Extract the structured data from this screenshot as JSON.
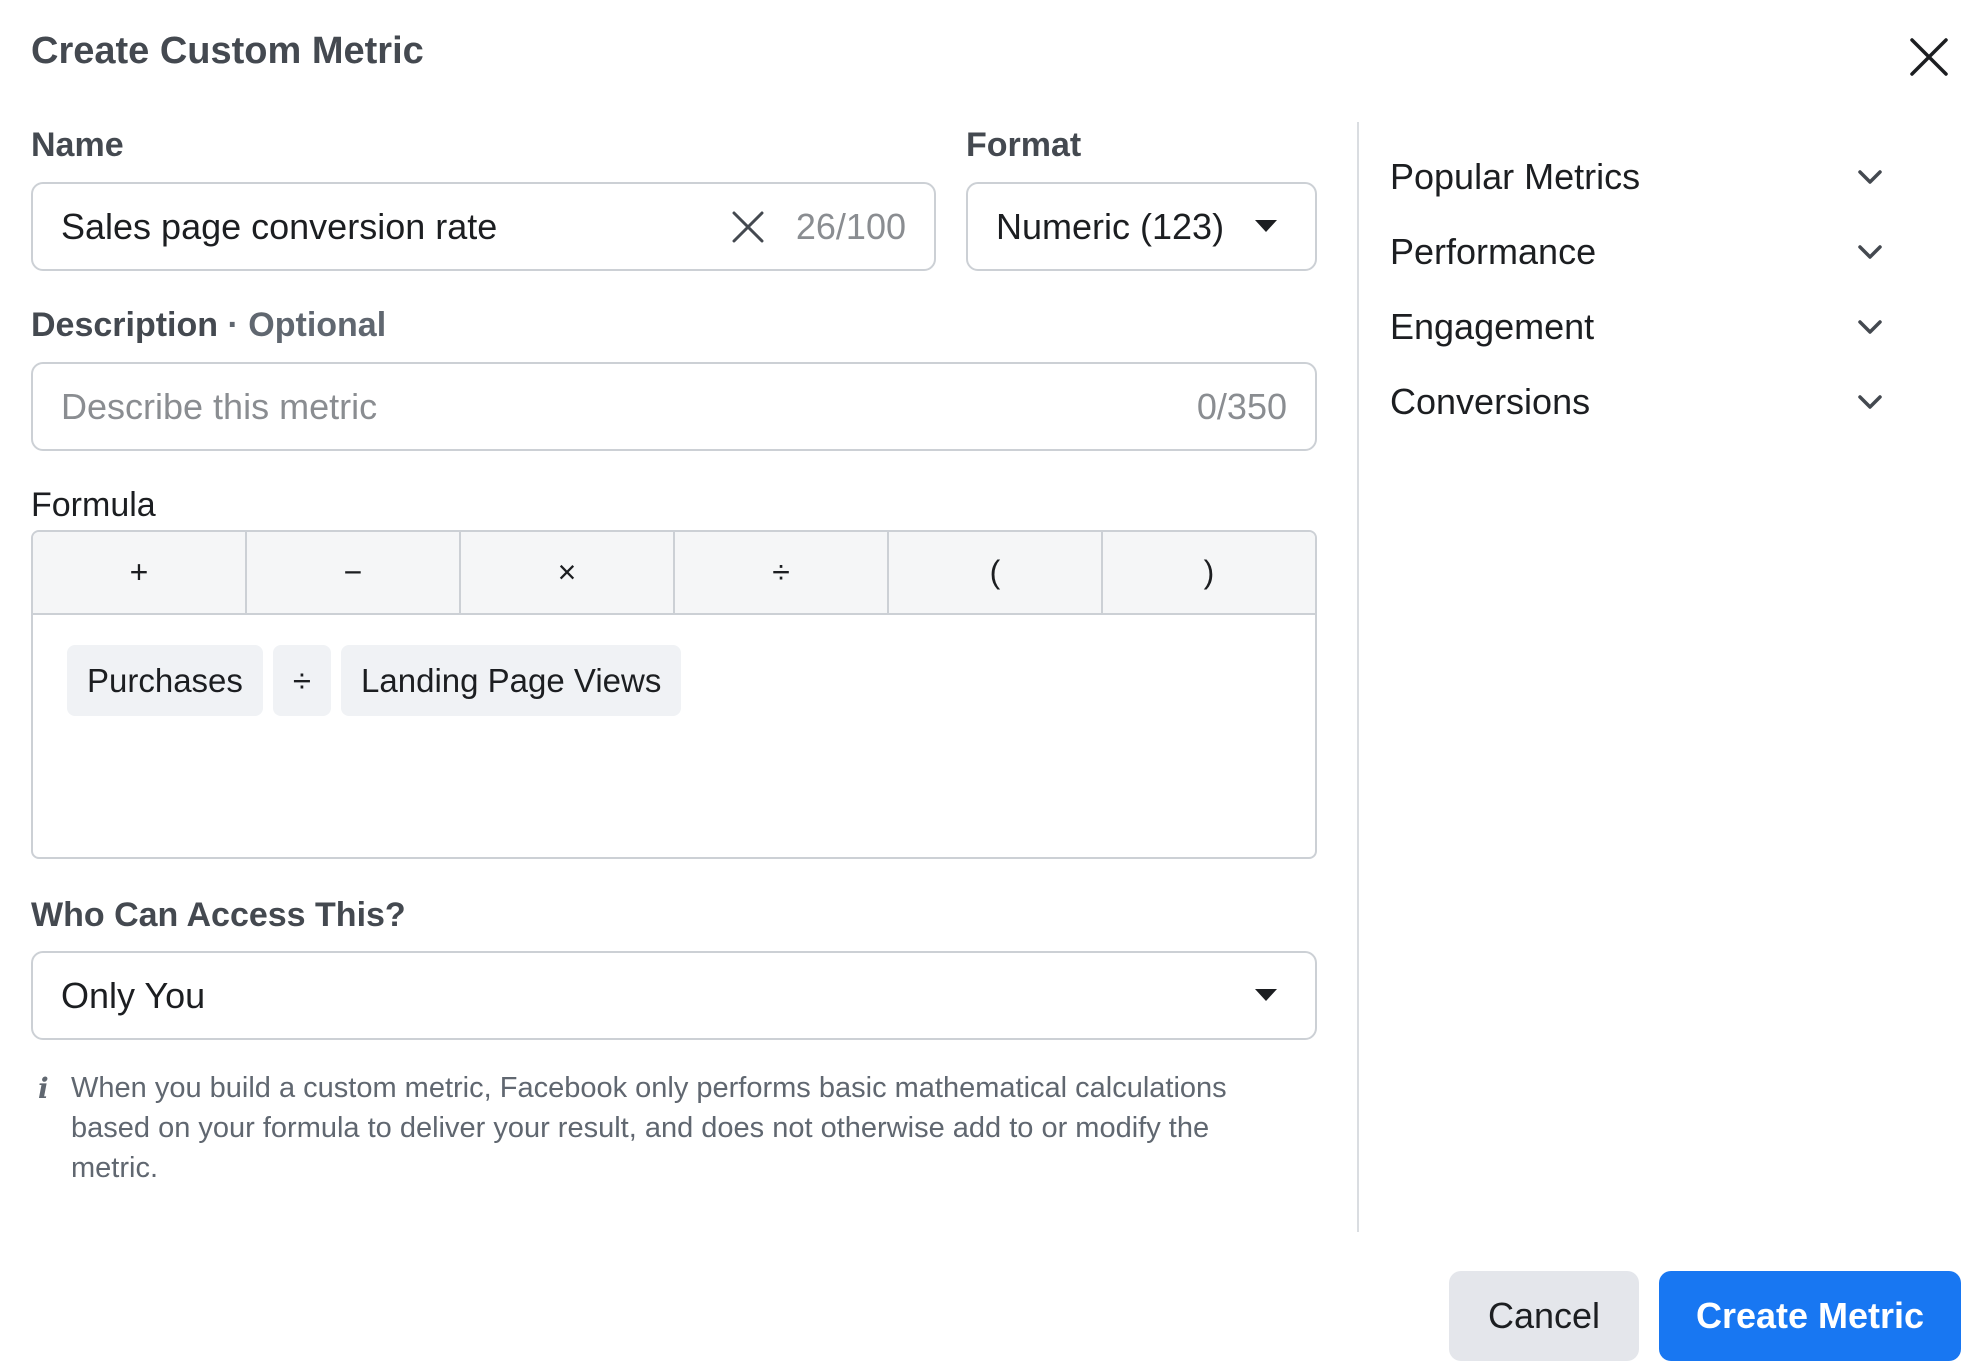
{
  "dialog": {
    "title": "Create Custom Metric",
    "close_icon": "close-icon"
  },
  "name": {
    "label": "Name",
    "value": "Sales page conversion rate",
    "counter": "26/100",
    "clear_icon": "clear-x-icon"
  },
  "format": {
    "label": "Format",
    "value": "Numeric (123)"
  },
  "description": {
    "label": "Description",
    "separator": "·",
    "optional": "Optional",
    "placeholder": "Describe this metric",
    "counter": "0/350"
  },
  "formula": {
    "label": "Formula",
    "operators": [
      "+",
      "−",
      "×",
      "÷",
      "(",
      ")"
    ],
    "tokens": [
      "Purchases",
      "÷",
      "Landing Page Views"
    ]
  },
  "access": {
    "label": "Who Can Access This?",
    "value": "Only You"
  },
  "info": {
    "icon": "info-icon",
    "text": "When you build a custom metric, Facebook only performs basic mathematical calculations based on your formula to deliver your result, and does not otherwise add to or modify the metric."
  },
  "sidebar": {
    "items": [
      {
        "label": "Popular Metrics"
      },
      {
        "label": "Performance"
      },
      {
        "label": "Engagement"
      },
      {
        "label": "Conversions"
      }
    ]
  },
  "footer": {
    "cancel_label": "Cancel",
    "create_label": "Create Metric"
  },
  "colors": {
    "primary": "#1877f2",
    "border": "#ccd0d5",
    "secondary_button": "#e4e6eb",
    "token_bg": "#f0f2f5"
  }
}
